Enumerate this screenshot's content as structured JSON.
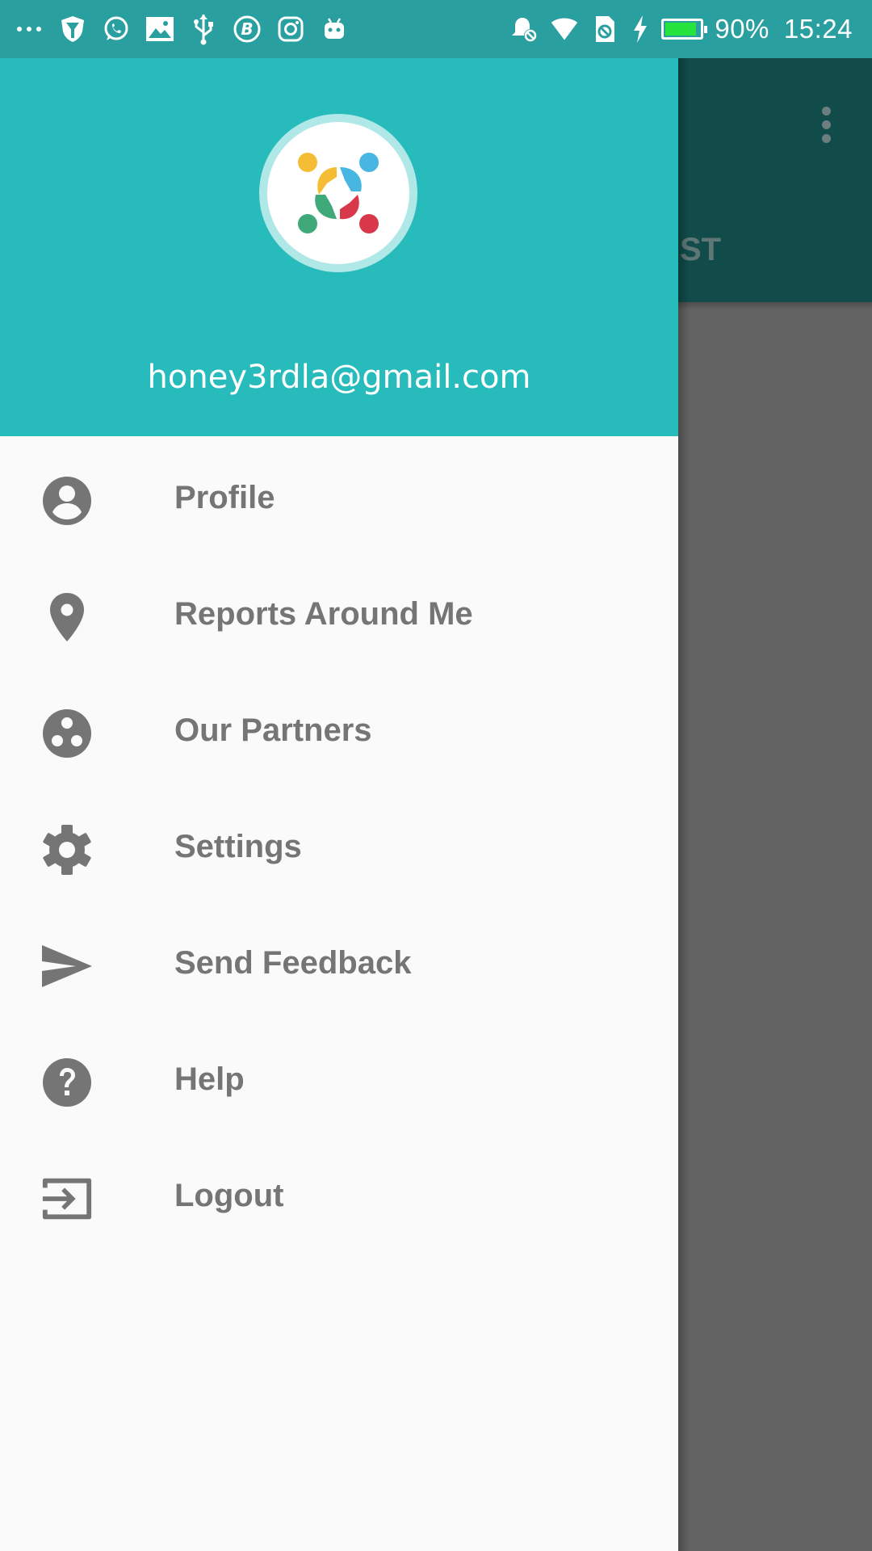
{
  "status_bar": {
    "battery_percent": "90%",
    "battery_level": 0.9,
    "time": "15:24",
    "left_icons": [
      "more-icon",
      "shield-icon",
      "whatsapp-icon",
      "gallery-icon",
      "usb-icon",
      "b-circle-icon",
      "instagram-icon",
      "android-icon"
    ],
    "right_icons": [
      "alarm-off-icon",
      "wifi-icon",
      "sim-blocked-icon",
      "charging-icon",
      "battery-icon"
    ]
  },
  "background_app": {
    "tab_fragment": "ST",
    "overflow_icon": "overflow-menu-icon"
  },
  "drawer": {
    "header": {
      "email": "honey3rdla@gmail.com",
      "avatar_icon": "community-logo-icon",
      "color": "#28bbbb"
    },
    "items": [
      {
        "label": "Profile",
        "icon": "account-circle-icon"
      },
      {
        "label": "Reports Around Me",
        "icon": "location-pin-icon"
      },
      {
        "label": "Our Partners",
        "icon": "partners-icon"
      },
      {
        "label": "Settings",
        "icon": "gear-icon"
      },
      {
        "label": "Send Feedback",
        "icon": "send-icon"
      },
      {
        "label": "Help",
        "icon": "help-icon"
      },
      {
        "label": "Logout",
        "icon": "logout-icon"
      }
    ]
  },
  "colors": {
    "status_bar": "#2a9f9f",
    "drawer_header": "#28bbbb",
    "app_bar_dimmed": "#114c4b",
    "menu_text": "#757575",
    "scrim": "#636363"
  }
}
